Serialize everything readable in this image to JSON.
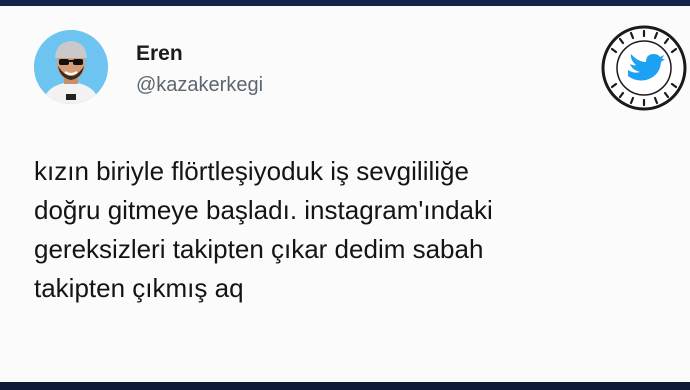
{
  "user": {
    "display_name": "Eren",
    "handle": "@kazakerkegi"
  },
  "tweet": {
    "lines": [
      "kızın biriyle flörtleşiyoduk iş sevgililiğe",
      "doğru gitmeye başladı. instagram'ındaki",
      "gereksizleri takipten çıkar dedim sabah",
      "takipten çıkmış aq"
    ]
  },
  "badge": {
    "icon": "bird-icon",
    "accent": "#1da1f2"
  },
  "colors": {
    "card_background": "#fbfbfb",
    "outer_background": "#0e1a35"
  }
}
